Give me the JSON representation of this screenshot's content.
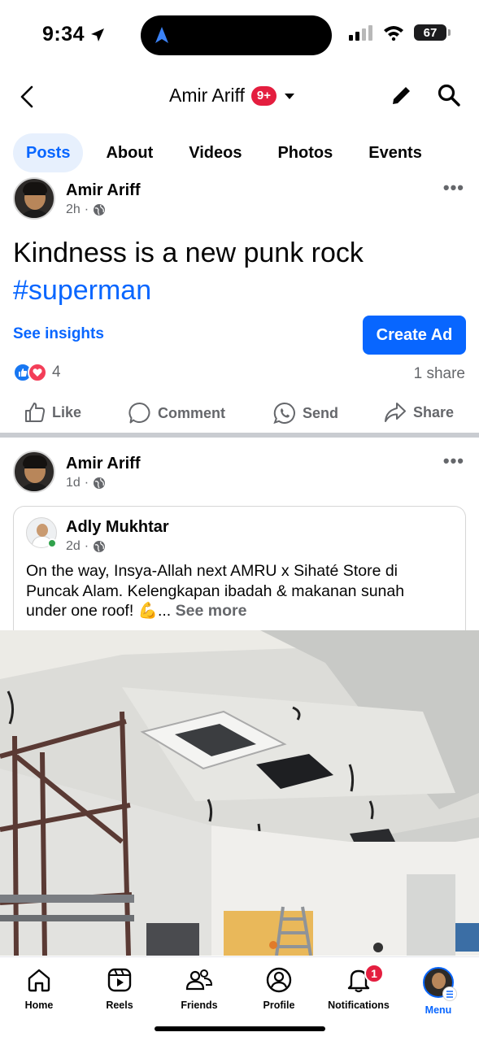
{
  "status_bar": {
    "time": "9:34",
    "battery": "67"
  },
  "header": {
    "title": "Amir Ariff",
    "badge": "9+"
  },
  "tabs": [
    {
      "label": "Posts",
      "active": true
    },
    {
      "label": "About"
    },
    {
      "label": "Videos"
    },
    {
      "label": "Photos"
    },
    {
      "label": "Events"
    }
  ],
  "post1": {
    "author": "Amir Ariff",
    "time": "2h",
    "text": "Kindness is a new punk rock",
    "hashtag": "#superman",
    "see_insights": "See insights",
    "create_ad": "Create Ad",
    "reaction_count": "4",
    "shares": "1 share"
  },
  "actions": {
    "like": "Like",
    "comment": "Comment",
    "send": "Send",
    "share": "Share"
  },
  "post2": {
    "author": "Amir Ariff",
    "time": "1d",
    "shared": {
      "author": "Adly Mukhtar",
      "time": "2d",
      "text": "On the way, Insya-Allah next AMRU x Sihaté Store di Puncak Alam. Kelengkapan ibadah & makanan sunah under one roof! 💪...",
      "see_more": "See more"
    }
  },
  "bottom_nav": {
    "home": "Home",
    "reels": "Reels",
    "friends": "Friends",
    "profile": "Profile",
    "notifications": "Notifications",
    "notifications_count": "1",
    "menu": "Menu"
  },
  "colors": {
    "accent": "#0866ff",
    "badge": "#e41e3f",
    "secondary_text": "#65676b"
  }
}
